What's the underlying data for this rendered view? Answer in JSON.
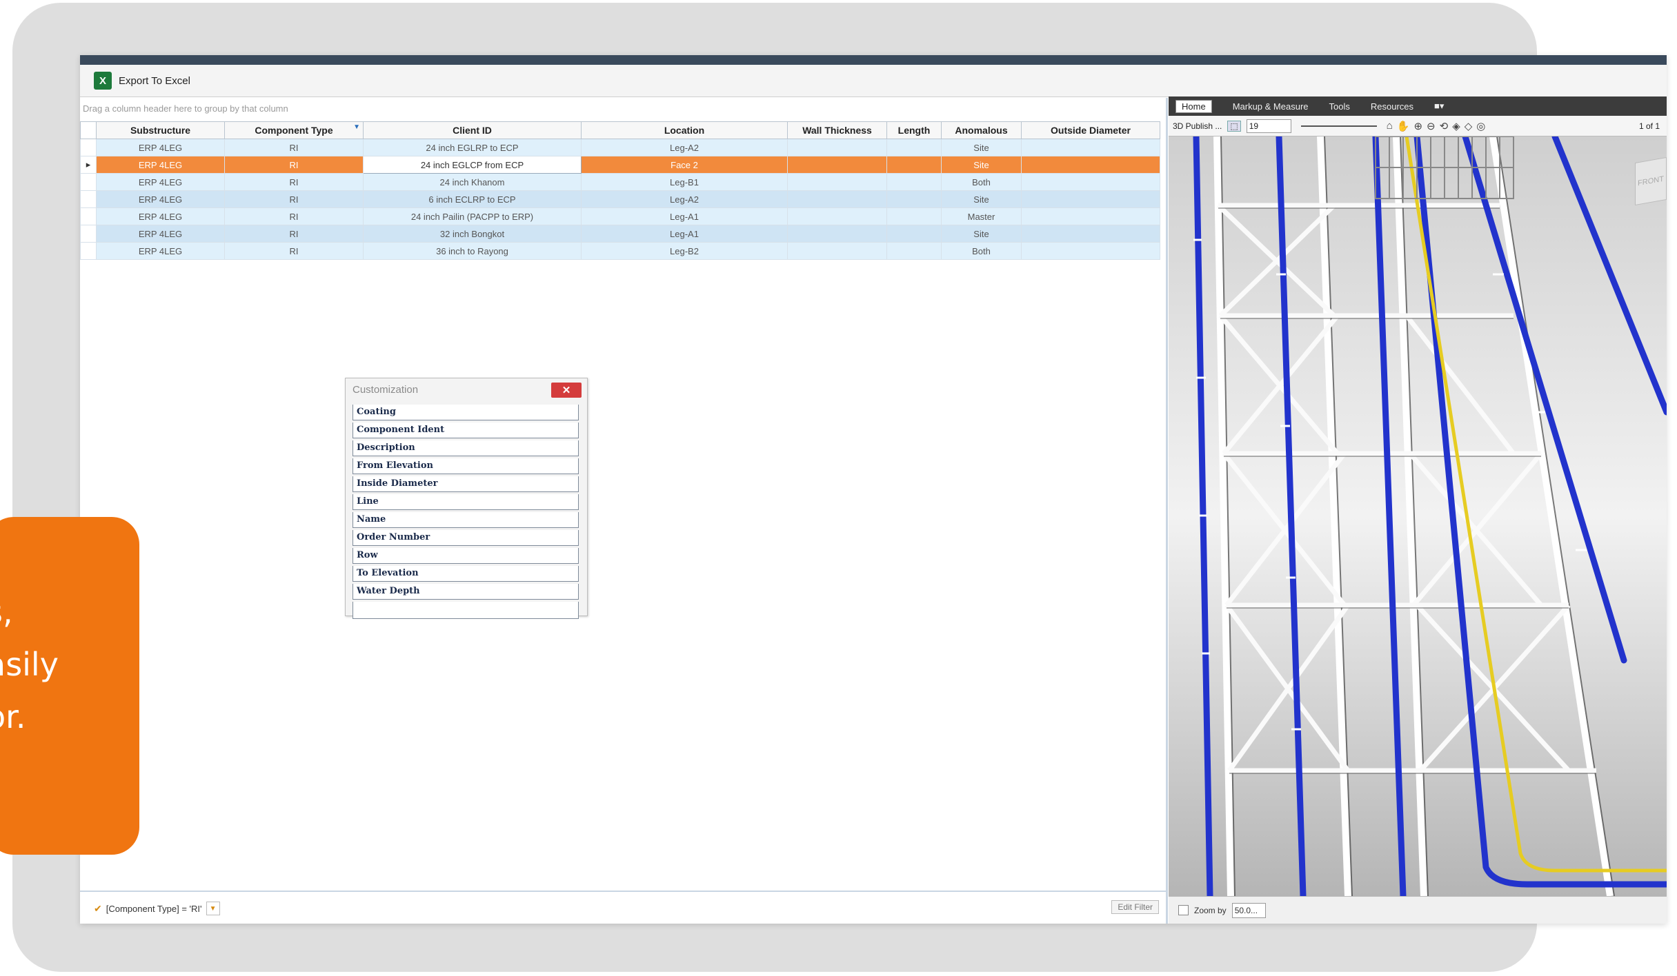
{
  "toolbar": {
    "export_label": "Export To Excel",
    "excel_icon_text": "X"
  },
  "grid": {
    "group_hint": "Drag a column header here to group by that column",
    "columns": [
      "Substructure",
      "Component Type",
      "Client ID",
      "Location",
      "Wall Thickness",
      "Length",
      "Anomalous",
      "Outside Diameter"
    ],
    "rows": [
      [
        "ERP 4LEG",
        "RI",
        "24 inch EGLRP to ECP",
        "Leg-A2",
        "",
        "",
        "Site",
        ""
      ],
      [
        "ERP 4LEG",
        "RI",
        "24 inch EGLCP from ECP",
        "Face 2",
        "",
        "",
        "Site",
        ""
      ],
      [
        "ERP 4LEG",
        "RI",
        "24 inch Khanom",
        "Leg-B1",
        "",
        "",
        "Both",
        ""
      ],
      [
        "ERP 4LEG",
        "RI",
        "6 inch ECLRP to ECP",
        "Leg-A2",
        "",
        "",
        "Site",
        ""
      ],
      [
        "ERP 4LEG",
        "RI",
        "24 inch Pailin (PACPP to ERP)",
        "Leg-A1",
        "",
        "",
        "Master",
        ""
      ],
      [
        "ERP 4LEG",
        "RI",
        "32 inch Bongkot",
        "Leg-A1",
        "",
        "",
        "Site",
        ""
      ],
      [
        "ERP 4LEG",
        "RI",
        "36 inch to Rayong",
        "Leg-B2",
        "",
        "",
        "Both",
        ""
      ]
    ]
  },
  "customization": {
    "title": "Customization",
    "close_label": "✕",
    "items": [
      "Coating",
      "Component Ident",
      "Description",
      "From Elevation",
      "Inside Diameter",
      "Line",
      "Name",
      "Order Number",
      "Row",
      "To Elevation",
      "Water Depth"
    ]
  },
  "status": {
    "filter_text": "[Component Type] = 'RI'",
    "edit_filter": "Edit Filter"
  },
  "viewer": {
    "tabs": [
      "Home",
      "Markup & Measure",
      "Tools",
      "Resources"
    ],
    "publish_label": "3D Publish ...",
    "zoom_select": "19",
    "page_label": "1 of 1",
    "front_label": "FRONT",
    "zoom_by_label": "Zoom by",
    "zoom_value": "50.0..."
  },
  "callout": {
    "lines": [
      "s,",
      "",
      "asily",
      "or."
    ]
  },
  "colors": {
    "accent_orange": "#f07511",
    "selected_row": "#f28a3c",
    "pipe_blue": "#2233cc",
    "pipe_yellow": "#e6cc22"
  }
}
